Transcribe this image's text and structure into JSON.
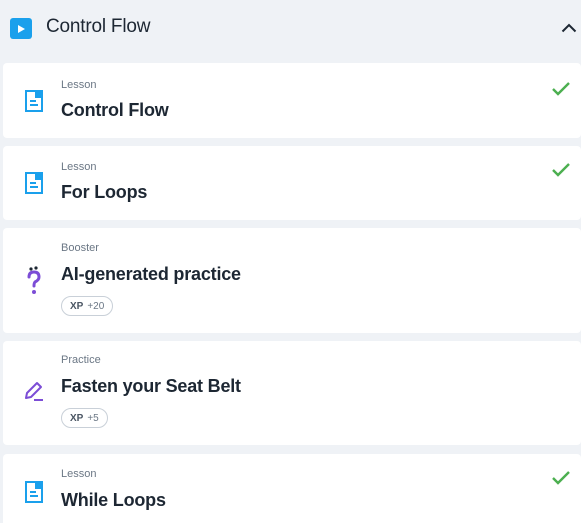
{
  "section": {
    "title": "Control Flow"
  },
  "items": [
    {
      "type": "Lesson",
      "title": "Control Flow",
      "completed": true
    },
    {
      "type": "Lesson",
      "title": "For Loops",
      "completed": true
    },
    {
      "type": "Booster",
      "title": "AI-generated practice",
      "xp_label": "XP",
      "xp_value": "+20"
    },
    {
      "type": "Practice",
      "title": "Fasten your Seat Belt",
      "xp_label": "XP",
      "xp_value": "+5"
    },
    {
      "type": "Lesson",
      "title": "While Loops",
      "completed": true
    }
  ],
  "colors": {
    "accent": "#1aa0ec",
    "check": "#4caf50",
    "purple": "#7c4dd6"
  }
}
